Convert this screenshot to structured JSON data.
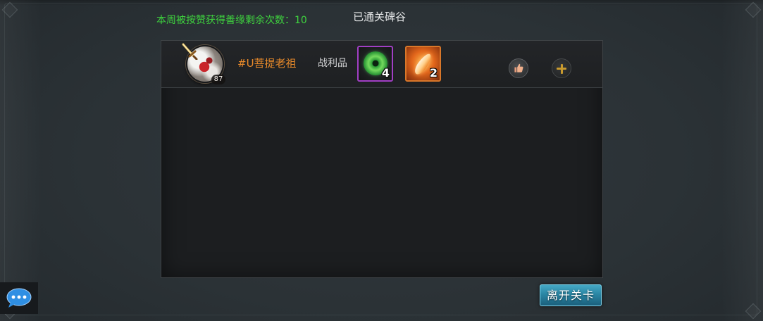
{
  "header": {
    "weekly_likes_text": "本周被按赞获得善缘剩余次数：10",
    "title": "已通关碑谷"
  },
  "players": [
    {
      "name": "#U菩提老祖",
      "level": "87",
      "avatar_icon": "red-demon-avatar-icon",
      "loot_label": "战利品",
      "loot": [
        {
          "icon": "green-jade-disc-icon",
          "count": "4",
          "rarity_color": "#a13fc4"
        },
        {
          "icon": "orange-feather-icon",
          "count": "2",
          "rarity_color": "#d9772a"
        }
      ]
    }
  ],
  "actions": {
    "like_icon": "thumbs-up-icon",
    "add_friend_icon": "plus-icon",
    "leave_label": "离开关卡"
  },
  "chat": {
    "icon": "chat-bubble-icon"
  },
  "colors": {
    "weekly_text": "#3ed23e",
    "player_name": "#e88a2a",
    "button_teal": "#2a86a4",
    "gold_plus": "#c89a2e"
  }
}
